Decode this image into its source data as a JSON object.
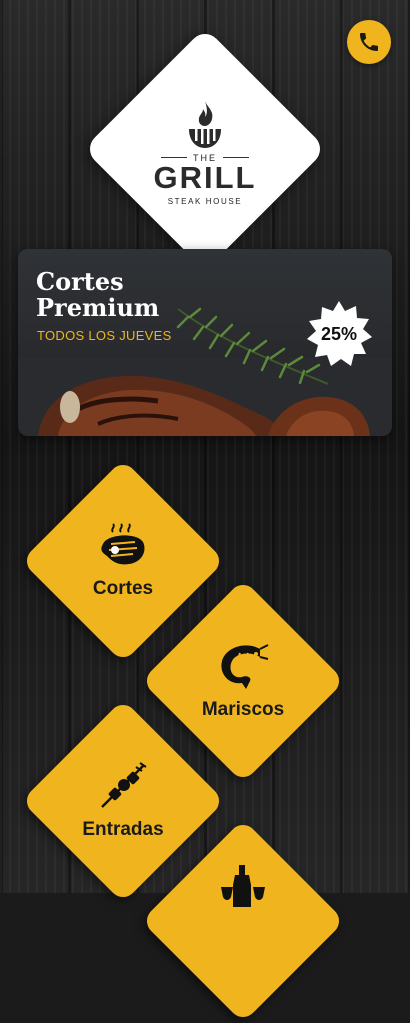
{
  "header": {
    "call_icon": "phone-icon"
  },
  "logo": {
    "the": "THE",
    "name": "GRILL",
    "subtitle": "STEAK HOUSE",
    "icon": "flame-grill-icon"
  },
  "promo": {
    "title_line1": "Cortes",
    "title_line2": "Premium",
    "subtitle": "TODOS LOS JUEVES",
    "badge": "25%"
  },
  "categories": [
    {
      "label": "Cortes",
      "icon": "steak-icon"
    },
    {
      "label": "Mariscos",
      "icon": "shrimp-icon"
    },
    {
      "label": "Entradas",
      "icon": "skewer-icon"
    },
    {
      "label": "",
      "icon": "drinks-icon"
    }
  ],
  "colors": {
    "accent": "#f0b51e",
    "background": "#1b1b1b",
    "logo_bg": "#ffffff"
  }
}
